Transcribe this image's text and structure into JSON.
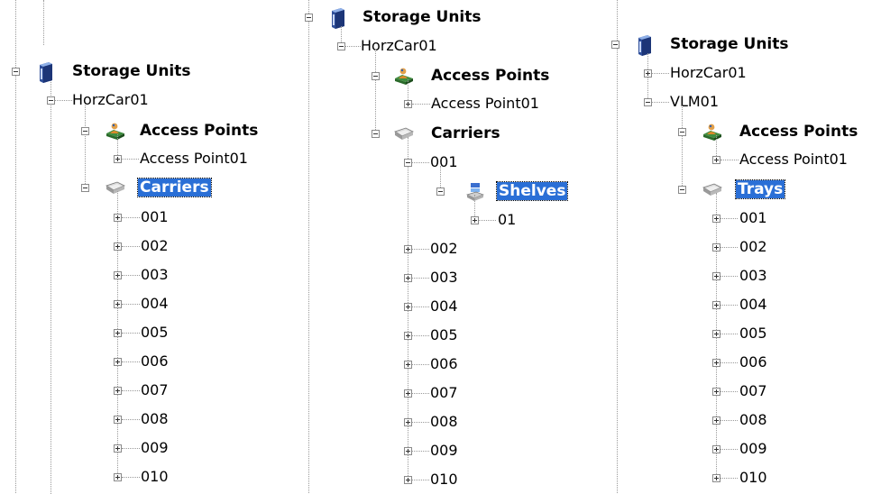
{
  "panels": [
    {
      "root": "Storage Units",
      "unit": "HorzCar01",
      "access_points_label": "Access Points",
      "access_point": "Access Point01",
      "carriers_label": "Carriers",
      "items": [
        "001",
        "002",
        "003",
        "004",
        "005",
        "006",
        "007",
        "008",
        "009",
        "010"
      ]
    },
    {
      "root": "Storage Units",
      "unit": "HorzCar01",
      "access_points_label": "Access Points",
      "access_point": "Access Point01",
      "carriers_label": "Carriers",
      "expanded_item": "001",
      "shelves_label": "Shelves",
      "shelf": "01",
      "items": [
        "002",
        "003",
        "004",
        "005",
        "006",
        "007",
        "008",
        "009",
        "010"
      ]
    },
    {
      "root": "Storage Units",
      "unit_collapsed": "HorzCar01",
      "unit": "VLM01",
      "access_points_label": "Access Points",
      "access_point": "Access Point01",
      "trays_label": "Trays",
      "items": [
        "001",
        "002",
        "003",
        "004",
        "005",
        "006",
        "007",
        "008",
        "009",
        "010"
      ]
    }
  ],
  "icons": {
    "storage": "storage-units-icon",
    "access": "access-points-icon",
    "carrier": "carrier-tray-icon",
    "shelf": "shelves-icon"
  },
  "colors": {
    "selection": "#2a6fd6",
    "tree_line": "#9a9a9a"
  }
}
